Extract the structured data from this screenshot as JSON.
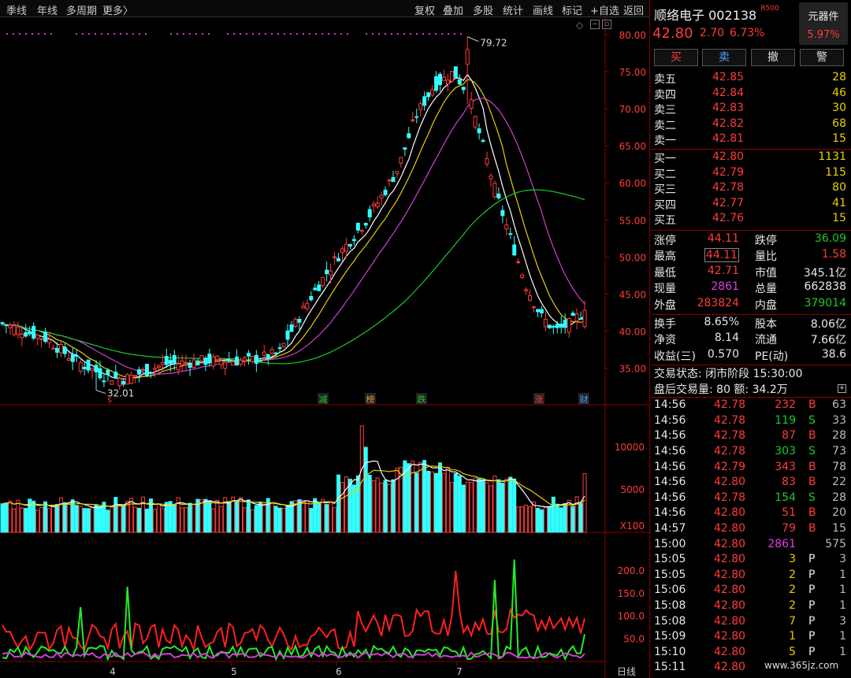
{
  "toolbar": {
    "left": [
      "季线",
      "年线",
      "多周期",
      "更多〉"
    ],
    "right": [
      "复权",
      "叠加",
      "多股",
      "统计",
      "画线",
      "标记",
      "+自选",
      "返回"
    ]
  },
  "stock": {
    "name": "顺络电子",
    "code": "002138",
    "badge": "R500",
    "sector": "元器件",
    "sector_pct": "5.97%",
    "price": "42.80",
    "change": "2.70",
    "pct": "6.73%"
  },
  "actions": [
    "买",
    "卖",
    "撤",
    "警"
  ],
  "asks": [
    {
      "label": "卖五",
      "price": "42.85",
      "vol": "28"
    },
    {
      "label": "卖四",
      "price": "42.84",
      "vol": "46"
    },
    {
      "label": "卖三",
      "price": "42.83",
      "vol": "30"
    },
    {
      "label": "卖二",
      "price": "42.82",
      "vol": "68"
    },
    {
      "label": "卖一",
      "price": "42.81",
      "vol": "15"
    }
  ],
  "bids": [
    {
      "label": "买一",
      "price": "42.80",
      "vol": "1131"
    },
    {
      "label": "买二",
      "price": "42.79",
      "vol": "115"
    },
    {
      "label": "买三",
      "price": "42.78",
      "vol": "80"
    },
    {
      "label": "买四",
      "price": "42.77",
      "vol": "41"
    },
    {
      "label": "买五",
      "price": "42.76",
      "vol": "15"
    }
  ],
  "stats1": [
    {
      "l1": "涨停",
      "v1": "44.11",
      "c1": "red",
      "l2": "跌停",
      "v2": "36.09",
      "c2": "green"
    },
    {
      "l1": "最高",
      "v1": "44.11",
      "c1": "red",
      "l2": "量比",
      "v2": "1.58",
      "c2": "red"
    },
    {
      "l1": "最低",
      "v1": "42.71",
      "c1": "red",
      "l2": "市值",
      "v2": "345.1亿",
      "c2": "white"
    },
    {
      "l1": "现量",
      "v1": "2861",
      "c1": "mag",
      "l2": "总量",
      "v2": "662838",
      "c2": "white"
    },
    {
      "l1": "外盘",
      "v1": "283824",
      "c1": "red",
      "l2": "内盘",
      "v2": "379014",
      "c2": "green"
    }
  ],
  "stats2": [
    {
      "l1": "换手",
      "v1": "8.65%",
      "l2": "股本",
      "v2": "8.06亿"
    },
    {
      "l1": "净资",
      "v1": "8.14",
      "l2": "流通",
      "v2": "7.66亿"
    },
    {
      "l1": "收益(三)",
      "v1": "0.570",
      "l2": "PE(动)",
      "v2": "38.6"
    }
  ],
  "status": {
    "line1": "交易状态: 闭市阶段 15:30:00",
    "line2": "盘后交易量: 80  额: 34.2万"
  },
  "ticks": [
    {
      "t": "14:56",
      "p": "42.78",
      "v": "232",
      "s": "B",
      "n": "63"
    },
    {
      "t": "14:56",
      "p": "42.78",
      "v": "119",
      "s": "S",
      "n": "33"
    },
    {
      "t": "14:56",
      "p": "42.78",
      "v": "87",
      "s": "B",
      "n": "28"
    },
    {
      "t": "14:56",
      "p": "42.78",
      "v": "303",
      "s": "S",
      "n": "73"
    },
    {
      "t": "14:56",
      "p": "42.79",
      "v": "343",
      "s": "B",
      "n": "78"
    },
    {
      "t": "14:56",
      "p": "42.80",
      "v": "83",
      "s": "B",
      "n": "22"
    },
    {
      "t": "14:56",
      "p": "42.78",
      "v": "154",
      "s": "S",
      "n": "28"
    },
    {
      "t": "14:56",
      "p": "42.80",
      "v": "51",
      "s": "B",
      "n": "20"
    },
    {
      "t": "14:57",
      "p": "42.80",
      "v": "79",
      "s": "B",
      "n": "15"
    },
    {
      "t": "15:00",
      "p": "42.80",
      "v": "2861",
      "s": "",
      "n": "575"
    },
    {
      "t": "15:05",
      "p": "42.80",
      "v": "3",
      "s": "P",
      "n": "3"
    },
    {
      "t": "15:05",
      "p": "42.80",
      "v": "2",
      "s": "P",
      "n": "1"
    },
    {
      "t": "15:06",
      "p": "42.80",
      "v": "2",
      "s": "P",
      "n": "1"
    },
    {
      "t": "15:08",
      "p": "42.80",
      "v": "2",
      "s": "P",
      "n": "1"
    },
    {
      "t": "15:08",
      "p": "42.80",
      "v": "7",
      "s": "P",
      "n": "3"
    },
    {
      "t": "15:09",
      "p": "42.80",
      "v": "1",
      "s": "P",
      "n": "1"
    },
    {
      "t": "15:10",
      "p": "42.80",
      "v": "5",
      "s": "P",
      "n": "1"
    },
    {
      "t": "15:11",
      "p": "42.80",
      "v": "",
      "s": "",
      "n": ""
    }
  ],
  "chart": {
    "price_axis": [
      "80.00",
      "75.00",
      "70.00",
      "65.00",
      "60.00",
      "55.00",
      "50.00",
      "45.00",
      "40.00",
      "35.00"
    ],
    "high_label": "79.72",
    "low_label": "32.01",
    "vol_axis": [
      "10000",
      "5000"
    ],
    "vol_unit": "X100",
    "ind_axis": [
      "200.0",
      "150.0",
      "100.0",
      "50.0"
    ],
    "x_labels": [
      "4",
      "5",
      "6",
      "7"
    ],
    "period": "日线",
    "markers": [
      {
        "text": "减",
        "color": "#19c92a"
      },
      {
        "text": "榜",
        "color": "#e89030"
      },
      {
        "text": "跌",
        "color": "#19c92a"
      },
      {
        "text": "涨",
        "color": "#ff3b3b"
      },
      {
        "text": "财",
        "color": "#4aa0ff"
      }
    ],
    "s_marker": "s"
  },
  "chart_data": {
    "type": "candlestick",
    "ylim": [
      32,
      80
    ],
    "x_labels": [
      "4",
      "5",
      "6",
      "7"
    ],
    "highlights": {
      "max": 79.72,
      "min": 32.01,
      "last_close": 42.8
    }
  },
  "watermark": "www.365jz.com"
}
